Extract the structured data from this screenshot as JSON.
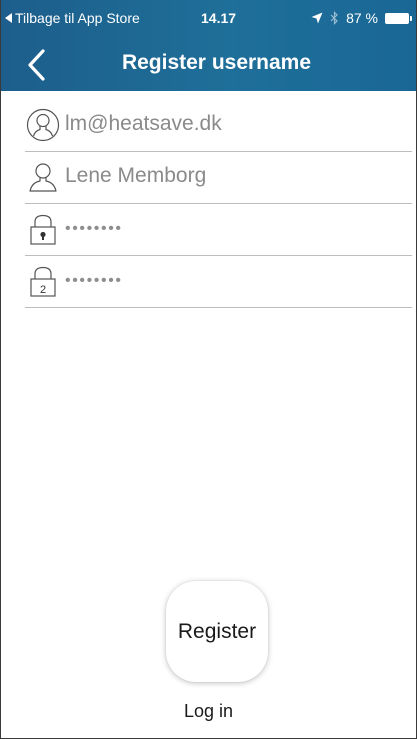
{
  "status_bar": {
    "back_app": "Tilbage til App Store",
    "time": "14.17",
    "battery": "87 %"
  },
  "nav": {
    "title": "Register username"
  },
  "form": {
    "email": {
      "value": "lm@heatsave.dk",
      "icon": "user-circle-icon"
    },
    "name": {
      "value": "Lene Memborg",
      "icon": "user-icon"
    },
    "password": {
      "value": "••••••••",
      "icon": "lock-icon"
    },
    "password_repeat": {
      "value": "••••••••",
      "icon": "lock-2-icon",
      "badge": "2"
    }
  },
  "actions": {
    "register_label": "Register",
    "login_label": "Log in"
  },
  "colors": {
    "header_start": "#1d5e8c",
    "header_end": "#1a6796"
  }
}
